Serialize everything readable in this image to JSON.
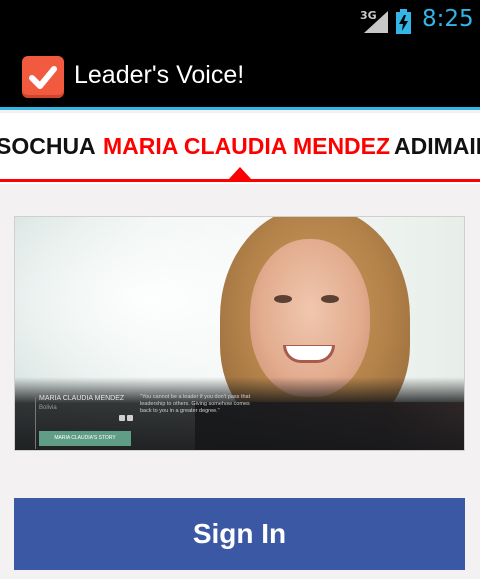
{
  "status_bar": {
    "network": "3G",
    "time": "8:25",
    "signal_color": "#c8c8c8",
    "time_color": "#33b5e5"
  },
  "action_bar": {
    "title": "Leader's Voice!",
    "icon": "checkbox-check-icon",
    "accent_color": "#33b5e5"
  },
  "tabs": {
    "items": [
      {
        "label": "SOCHUA"
      },
      {
        "label": "MARIA CLAUDIA MENDEZ",
        "selected": true
      },
      {
        "label": "ADIMAIN"
      }
    ],
    "indicator_color": "#ff0000"
  },
  "hero": {
    "name": "MARIA CLAUDIA MENDEZ",
    "country": "Bolivia",
    "quote": "\"You cannot be a leader if you don't pass that leadership to others. Giving somehow comes back to you in a greater degree.\"",
    "story_button": "MARIA CLAUDIA'S STORY",
    "social_icons": [
      "facebook-icon",
      "twitter-icon"
    ]
  },
  "signin": {
    "label": "Sign In",
    "color": "#3b58a5"
  }
}
